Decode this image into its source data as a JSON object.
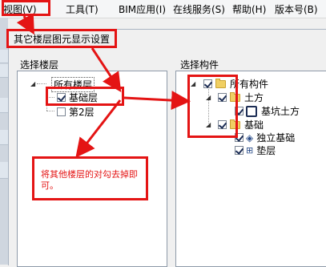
{
  "menubar": {
    "items": [
      "视图(V)",
      "工具(T)",
      "BIM应用(I)",
      "在线服务(S)",
      "帮助(H)",
      "版本号(B)"
    ]
  },
  "dialog": {
    "title": "其它楼层图元显示设置",
    "left_panel": {
      "title": "选择楼层",
      "root": "所有楼层",
      "floors": [
        {
          "label": "基础层",
          "checked": true
        },
        {
          "label": "第2层",
          "checked": false
        }
      ]
    },
    "right_panel": {
      "title": "选择构件",
      "root": "所有构件",
      "groups": [
        {
          "label": "土方",
          "children": [
            "基坑土方"
          ]
        },
        {
          "label": "基础",
          "children": [
            "独立基础",
            "垫层"
          ]
        }
      ]
    }
  },
  "annotation": {
    "text": "将其他楼层的对勾去掉即可。",
    "color": "#e41414"
  }
}
